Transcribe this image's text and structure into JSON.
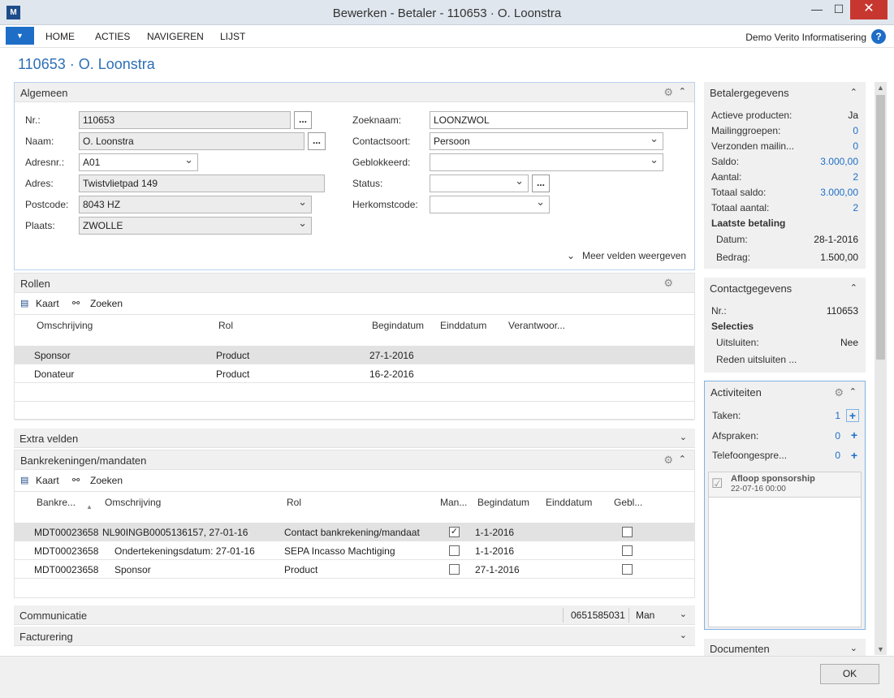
{
  "window": {
    "title": "Bewerken - Betaler - 110653 · O. Loonstra",
    "min": "—",
    "max": "☐",
    "close": "✕"
  },
  "ribbon": {
    "tabs": [
      "HOME",
      "ACTIES",
      "NAVIGEREN",
      "LIJST"
    ],
    "company": "Demo Verito Informatisering",
    "help": "?",
    "drop": "▼"
  },
  "page_title": "110653 · O. Loonstra",
  "algemeen": {
    "label": "Algemeen",
    "left": [
      {
        "label": "Nr.:",
        "value": "110653"
      },
      {
        "label": "Naam:",
        "value": "O. Loonstra"
      },
      {
        "label": "Adresnr.:",
        "value": "A01"
      },
      {
        "label": "Adres:",
        "value": "Twistvlietpad 149"
      },
      {
        "label": "Postcode:",
        "value": "8043 HZ"
      },
      {
        "label": "Plaats:",
        "value": "ZWOLLE"
      }
    ],
    "right": [
      {
        "label": "Zoeknaam:",
        "value": "LOONZWOL"
      },
      {
        "label": "Contactsoort:",
        "value": "Persoon"
      },
      {
        "label": "Geblokkeerd:",
        "value": ""
      },
      {
        "label": "Status:",
        "value": ""
      },
      {
        "label": "Herkomstcode:",
        "value": ""
      }
    ],
    "more": "Meer velden weergeven",
    "ellipsis": "..."
  },
  "rollen": {
    "label": "Rollen",
    "toolbar": {
      "kaart": "Kaart",
      "zoeken": "Zoeken"
    },
    "columns": [
      "Omschrijving",
      "Rol",
      "Begindatum",
      "Einddatum",
      "Verantwoor..."
    ],
    "rows": [
      {
        "omschrijving": "Sponsor",
        "rol": "Product",
        "begindatum": "27-1-2016"
      },
      {
        "omschrijving": "Donateur",
        "rol": "Product",
        "begindatum": "16-2-2016"
      }
    ]
  },
  "extra_velden": {
    "label": "Extra velden"
  },
  "bank": {
    "label": "Bankrekeningen/mandaten",
    "toolbar": {
      "kaart": "Kaart",
      "zoeken": "Zoeken"
    },
    "columns": [
      "Bankre...",
      "Omschrijving",
      "Rol",
      "Man...",
      "Begindatum",
      "Einddatum",
      "Gebl..."
    ],
    "rows": [
      {
        "nr": "MDT00023658",
        "omschrijving": "NL90INGB0005136157, 27-01-16",
        "rol": "Contact bankrekening/mandaat",
        "man": "✓",
        "begin": "1-1-2016",
        "gebl": ""
      },
      {
        "nr": "MDT00023658",
        "omschrijving": "Ondertekeningsdatum: 27-01-16",
        "rol": "SEPA Incasso Machtiging",
        "man": "",
        "begin": "1-1-2016",
        "gebl": ""
      },
      {
        "nr": "MDT00023658",
        "omschrijving": "Sponsor",
        "rol": "Product",
        "man": "",
        "begin": "27-1-2016",
        "gebl": ""
      }
    ]
  },
  "communicatie": {
    "label": "Communicatie",
    "phone": "0651585031",
    "gender": "Man"
  },
  "facturering": {
    "label": "Facturering"
  },
  "betaler": {
    "label": "Betalergegevens",
    "rows": [
      {
        "k": "Actieve producten:",
        "v": "Ja"
      },
      {
        "k": "Mailinggroepen:",
        "v": "0"
      },
      {
        "k": "Verzonden mailin...",
        "v": "0"
      },
      {
        "k": "Saldo:",
        "v": "3.000,00"
      },
      {
        "k": "Aantal:",
        "v": "2"
      },
      {
        "k": "Totaal saldo:",
        "v": "3.000,00"
      },
      {
        "k": "Totaal aantal:",
        "v": "2"
      }
    ],
    "laatste": "Laatste betaling",
    "datum_k": "Datum:",
    "datum_v": "28-1-2016",
    "bedrag_k": "Bedrag:",
    "bedrag_v": "1.500,00"
  },
  "contact": {
    "label": "Contactgegevens",
    "nr_k": "Nr.:",
    "nr_v": "110653",
    "selecties": "Selecties",
    "uitsluiten_k": "Uitsluiten:",
    "uitsluiten_v": "Nee",
    "reden": "Reden uitsluiten ..."
  },
  "activiteiten": {
    "label": "Activiteiten",
    "rows": [
      {
        "k": "Taken:",
        "v": "1"
      },
      {
        "k": "Afspraken:",
        "v": "0"
      },
      {
        "k": "Telefoongespre...",
        "v": "0"
      }
    ],
    "task": {
      "title": "Afloop sponsorship",
      "date": "22-07-16 00:00"
    }
  },
  "documenten": {
    "label": "Documenten"
  },
  "footer": {
    "ok": "OK"
  }
}
